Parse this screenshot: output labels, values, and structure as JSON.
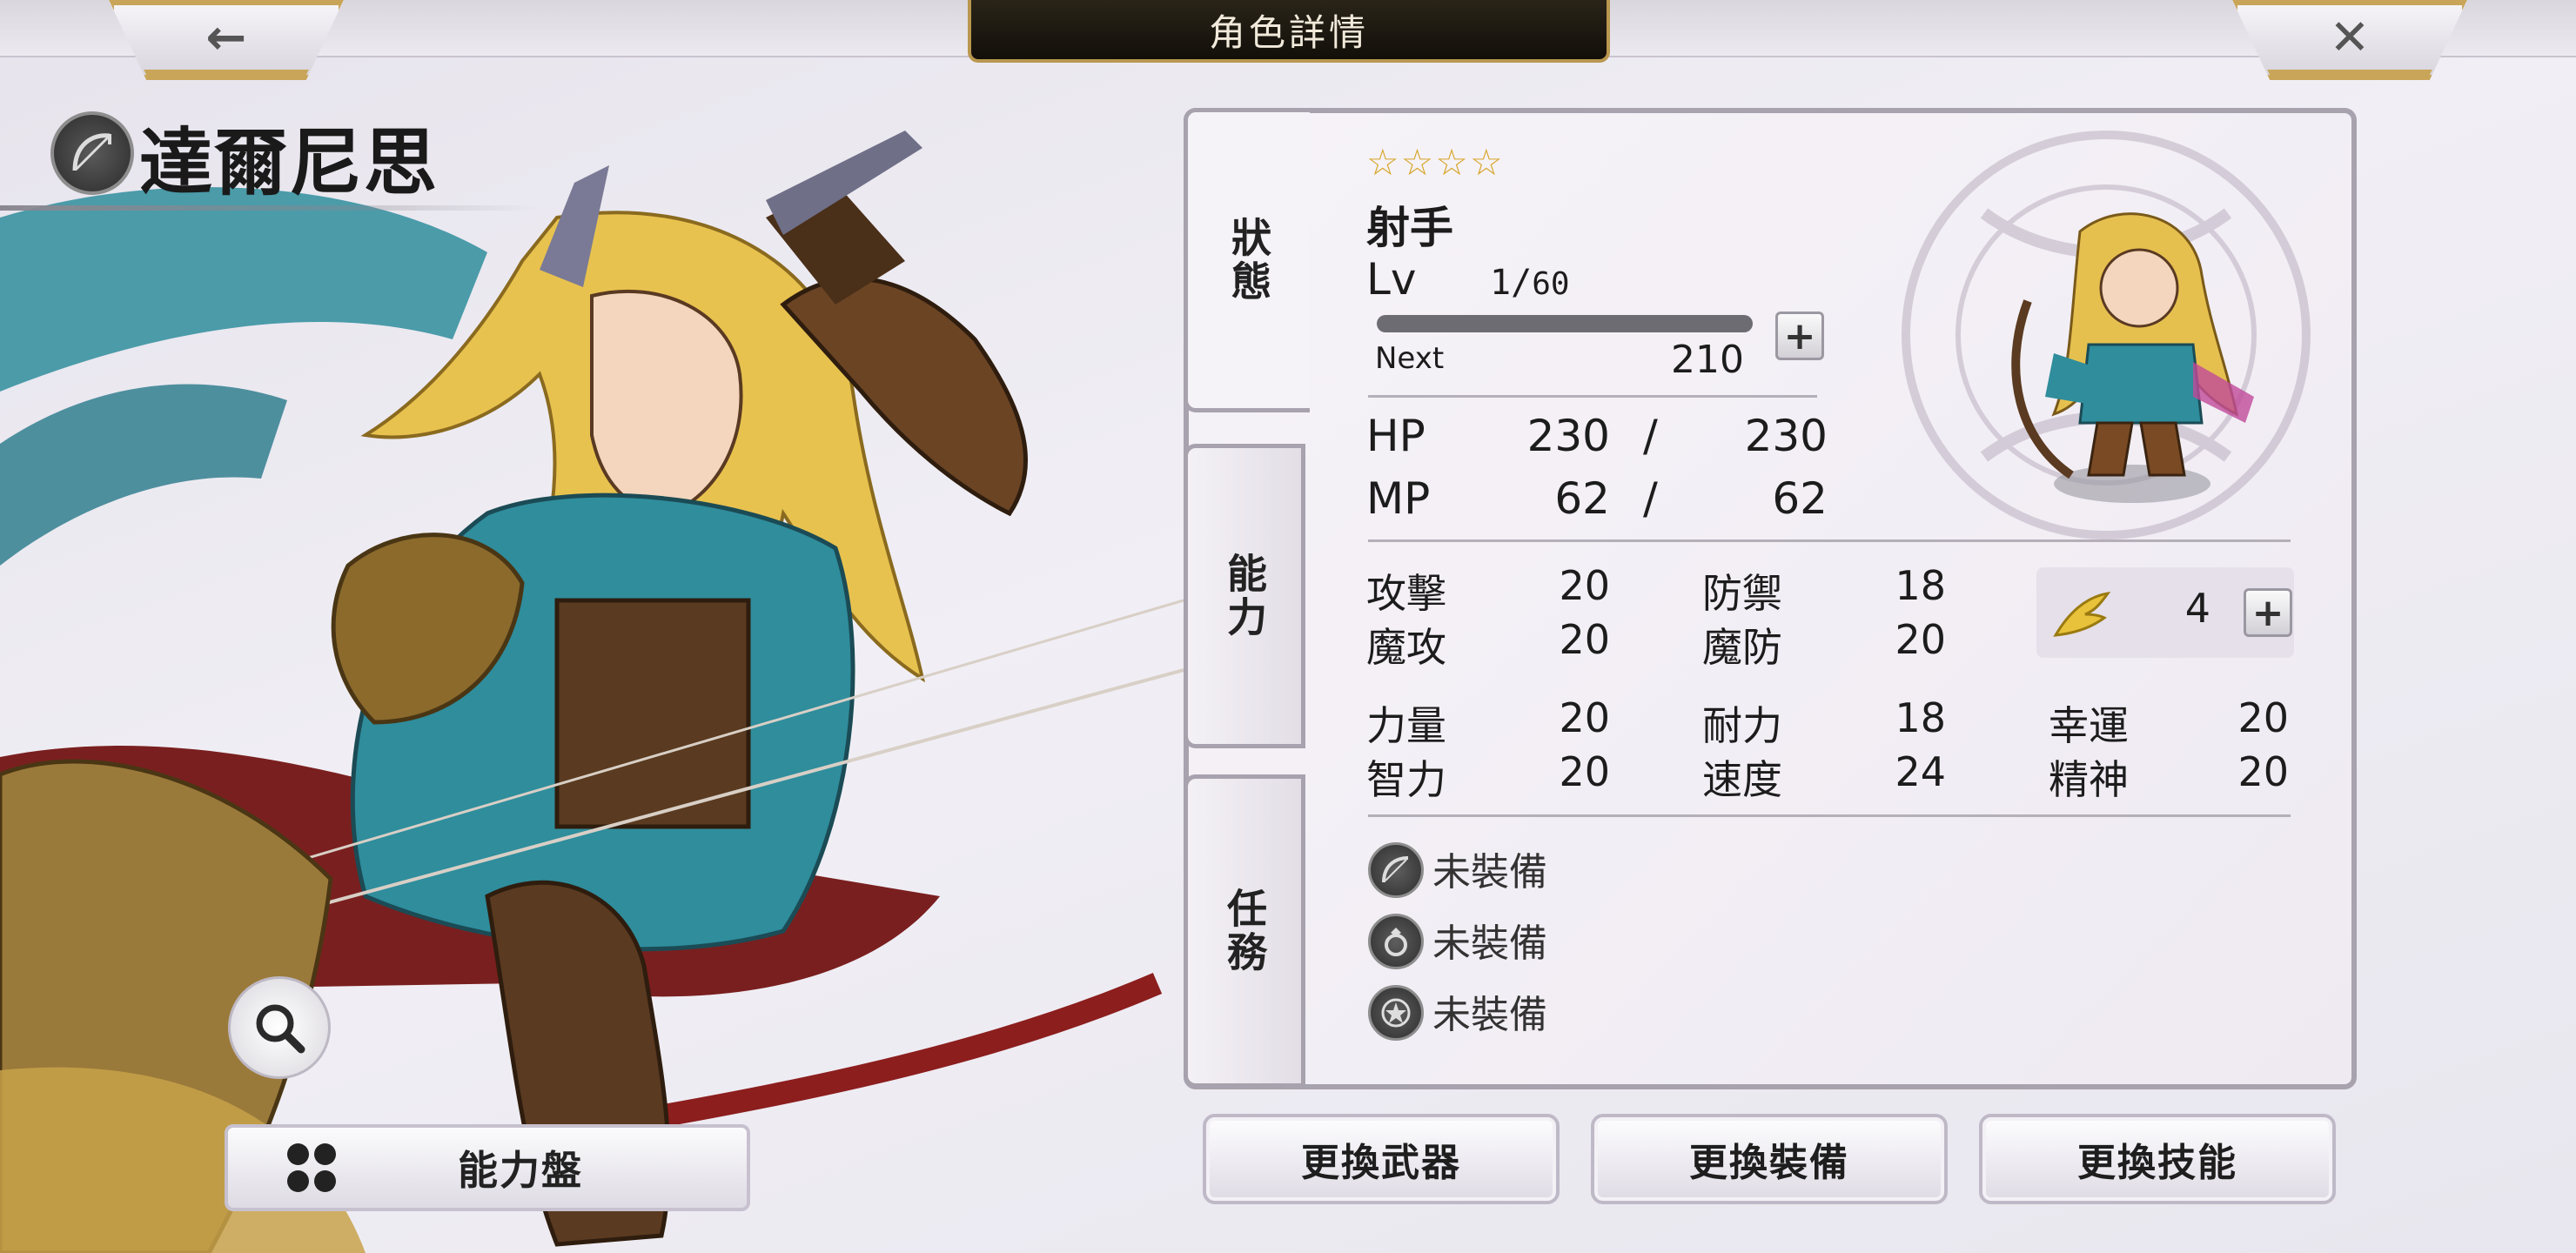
{
  "header": {
    "title": "角色詳情",
    "back_icon": "←",
    "close_icon": "✕"
  },
  "character": {
    "name": "達爾尼思",
    "class_icon": "bow-class-icon",
    "stars": "☆☆☆☆",
    "job": "射手",
    "lv_label": "Lv",
    "lv_current": "1",
    "lv_sep": "/",
    "lv_max": "60",
    "next_label": "Next",
    "next_value": "210",
    "exp_plus": "+"
  },
  "vitals": {
    "hp_label": "HP",
    "hp_current": "230",
    "hp_sep": "/",
    "hp_max": "230",
    "mp_label": "MP",
    "mp_current": "62",
    "mp_sep": "/",
    "mp_max": "62"
  },
  "stats": {
    "atk_label": "攻擊",
    "atk": "20",
    "def_label": "防禦",
    "def": "18",
    "matk_label": "魔攻",
    "matk": "20",
    "mdef_label": "魔防",
    "mdef": "20",
    "str_label": "力量",
    "str": "20",
    "end_label": "耐力",
    "end": "18",
    "luck_label": "幸運",
    "luck": "20",
    "int_label": "智力",
    "int": "20",
    "spd_label": "速度",
    "spd": "24",
    "spi_label": "精神",
    "spi": "20",
    "wing_value": "4",
    "wing_plus": "+"
  },
  "equipment": [
    {
      "slot_icon": "bow-slot-icon",
      "label": "未裝備"
    },
    {
      "slot_icon": "ring-slot-icon",
      "label": "未裝備"
    },
    {
      "slot_icon": "emblem-slot-icon",
      "label": "未裝備"
    }
  ],
  "tabs": {
    "status": "狀態",
    "ability": "能力",
    "quest": "任務"
  },
  "buttons": {
    "ability_board": "能力盤",
    "change_weapon": "更換武器",
    "change_equipment": "更換裝備",
    "change_skill": "更換技能"
  },
  "colors": {
    "accent_gold": "#c9a55a",
    "panel_border": "#a7a2ad",
    "star": "#d7a62b",
    "wing": "#e8c23a"
  }
}
